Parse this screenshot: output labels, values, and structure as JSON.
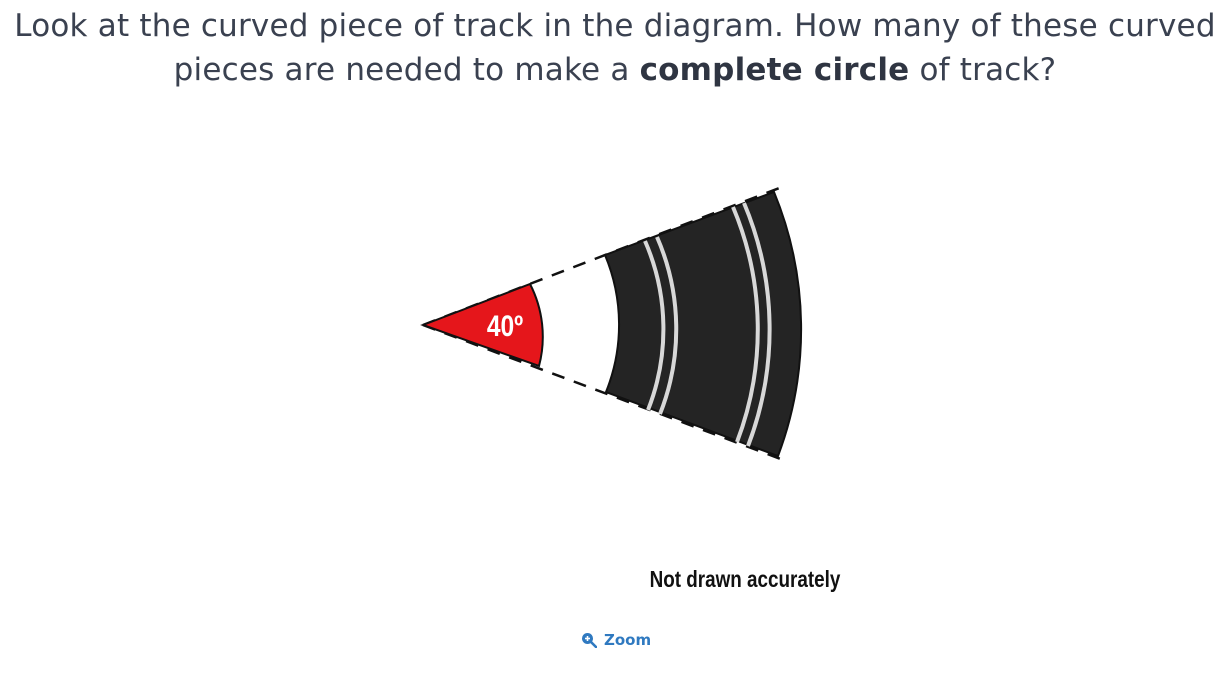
{
  "question": {
    "text_before": "Look at the curved piece of track in the diagram. How many of these curved pieces are needed to make a ",
    "emphasis": "complete circle",
    "text_after": " of track?"
  },
  "diagram": {
    "angle_label": "40º",
    "caption": "Not drawn accurately",
    "colors": {
      "sector": "#e5161b",
      "track": "#242424",
      "stripe": "#d8d8d8"
    }
  },
  "zoom": {
    "label": "Zoom",
    "icon": "zoom-in-icon"
  }
}
